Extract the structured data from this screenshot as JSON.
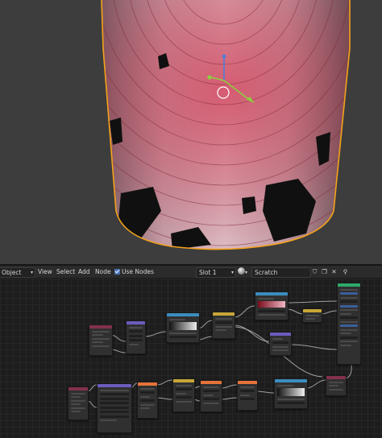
{
  "header": {
    "mode_label": "Object",
    "menu": {
      "view": "View",
      "select": "Select",
      "add": "Add",
      "node": "Node"
    },
    "use_nodes_label": "Use Nodes",
    "slot_label": "Slot 1",
    "material_name": "Scratch"
  },
  "icons": [
    "dropdown-arrow-icon",
    "checkbox-icon",
    "material-sphere-icon",
    "shield-icon",
    "duplicate-icon",
    "delete-icon",
    "pin-icon",
    "gizmo-icon"
  ],
  "colors": {
    "viewport_bg": "#3d3d3d",
    "selection_outline": "#f4a21a",
    "node_header_input": "#83314a",
    "node_header_texture": "#e5733a",
    "node_header_converter": "#3b8dbd",
    "node_header_vector": "#6b5bbd",
    "node_header_shader": "#2eaa6a",
    "node_header_color": "#c8a637"
  }
}
